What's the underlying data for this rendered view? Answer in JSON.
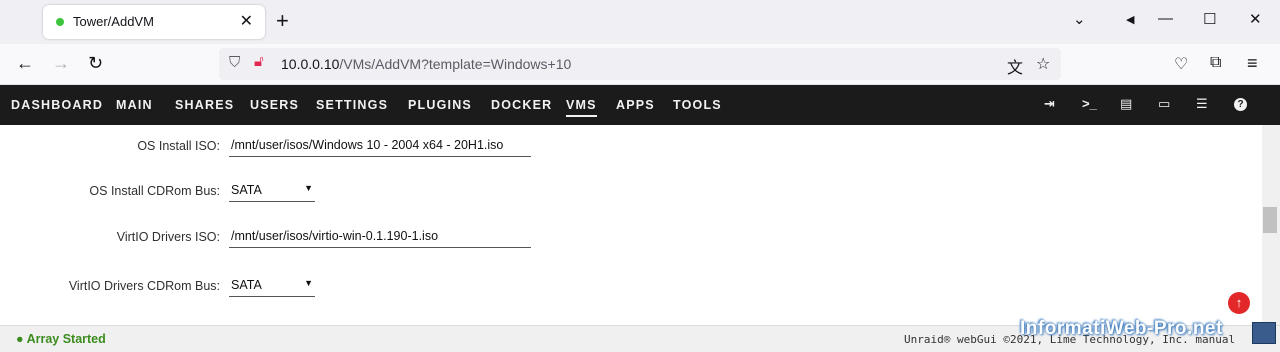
{
  "browser": {
    "tab_title": "Tower/AddVM",
    "url_host": "10.0.0.10",
    "url_path": "/VMs/AddVM?template=Windows+10"
  },
  "menu": {
    "items": [
      "DASHBOARD",
      "MAIN",
      "SHARES",
      "USERS",
      "SETTINGS",
      "PLUGINS",
      "DOCKER",
      "VMS",
      "APPS",
      "TOOLS"
    ],
    "active": "VMS"
  },
  "form": {
    "os_install_iso_label": "OS Install ISO:",
    "os_install_iso_value": "/mnt/user/isos/Windows 10 - 2004 x64 - 20H1.iso",
    "os_install_bus_label": "OS Install CDRom Bus:",
    "os_install_bus_value": "SATA",
    "virtio_iso_label": "VirtIO Drivers ISO:",
    "virtio_iso_value": "/mnt/user/isos/virtio-win-0.1.190-1.iso",
    "virtio_bus_label": "VirtIO Drivers CDRom Bus:",
    "virtio_bus_value": "SATA"
  },
  "footer": {
    "array_status": "Array Started",
    "copyright": "Unraid® webGui ©2021, Lime Technology, Inc. manual"
  },
  "watermark": "InformatiWeb-Pro.net",
  "colors": {
    "menubar_bg": "#1c1b1b",
    "array_status": "#3b8c1e",
    "up_button": "#e22828"
  }
}
